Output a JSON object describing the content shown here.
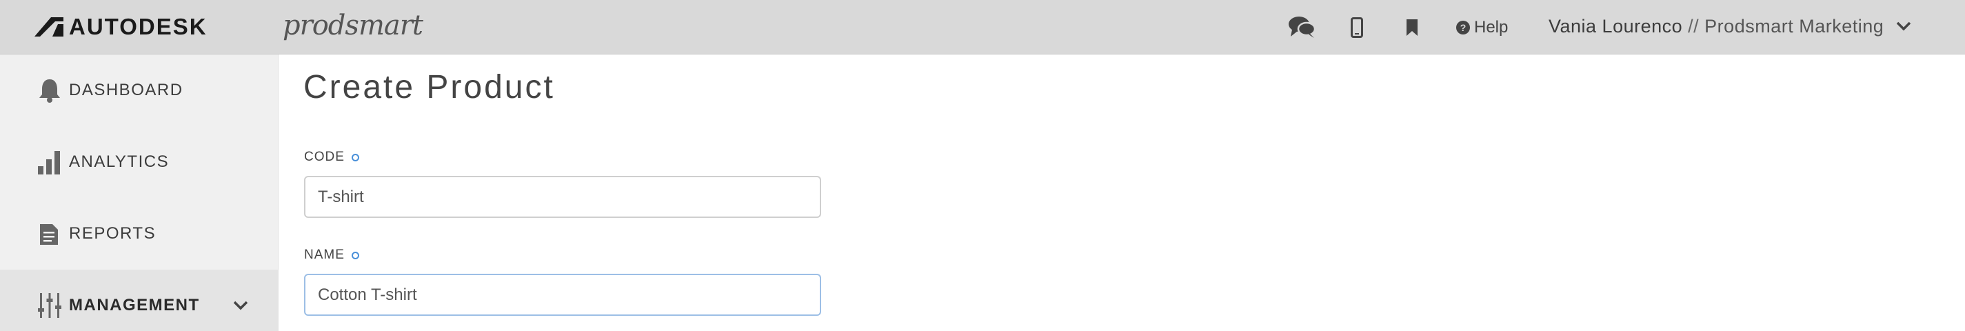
{
  "header": {
    "brand": "AUTODESK",
    "product": "prodsmart",
    "help_label": "Help",
    "user_name": "Vania Lourenco",
    "separator": "//",
    "organization": "Prodsmart Marketing",
    "icons": [
      "chat-icon",
      "mobile-icon",
      "bookmark-icon",
      "help-circle-icon",
      "chevron-down-icon"
    ]
  },
  "sidebar": {
    "items": [
      {
        "label": "DASHBOARD",
        "icon": "bell-icon",
        "active": false
      },
      {
        "label": "ANALYTICS",
        "icon": "bar-chart-icon",
        "active": false
      },
      {
        "label": "REPORTS",
        "icon": "document-icon",
        "active": false
      },
      {
        "label": "MANAGEMENT",
        "icon": "sliders-icon",
        "active": true,
        "expandable": true
      }
    ]
  },
  "main": {
    "title": "Create Product",
    "fields": [
      {
        "label": "CODE",
        "value": "T-shirt",
        "required": true
      },
      {
        "label": "NAME",
        "value": "Cotton T-shirt",
        "required": true,
        "focused": true
      }
    ]
  },
  "colors": {
    "topbar": "#d9d9d9",
    "sidebar": "#f0f0f0",
    "sidebar_active": "#e4e4e4",
    "required_marker": "#4a90d9",
    "focus_border": "#9dbfe6"
  }
}
